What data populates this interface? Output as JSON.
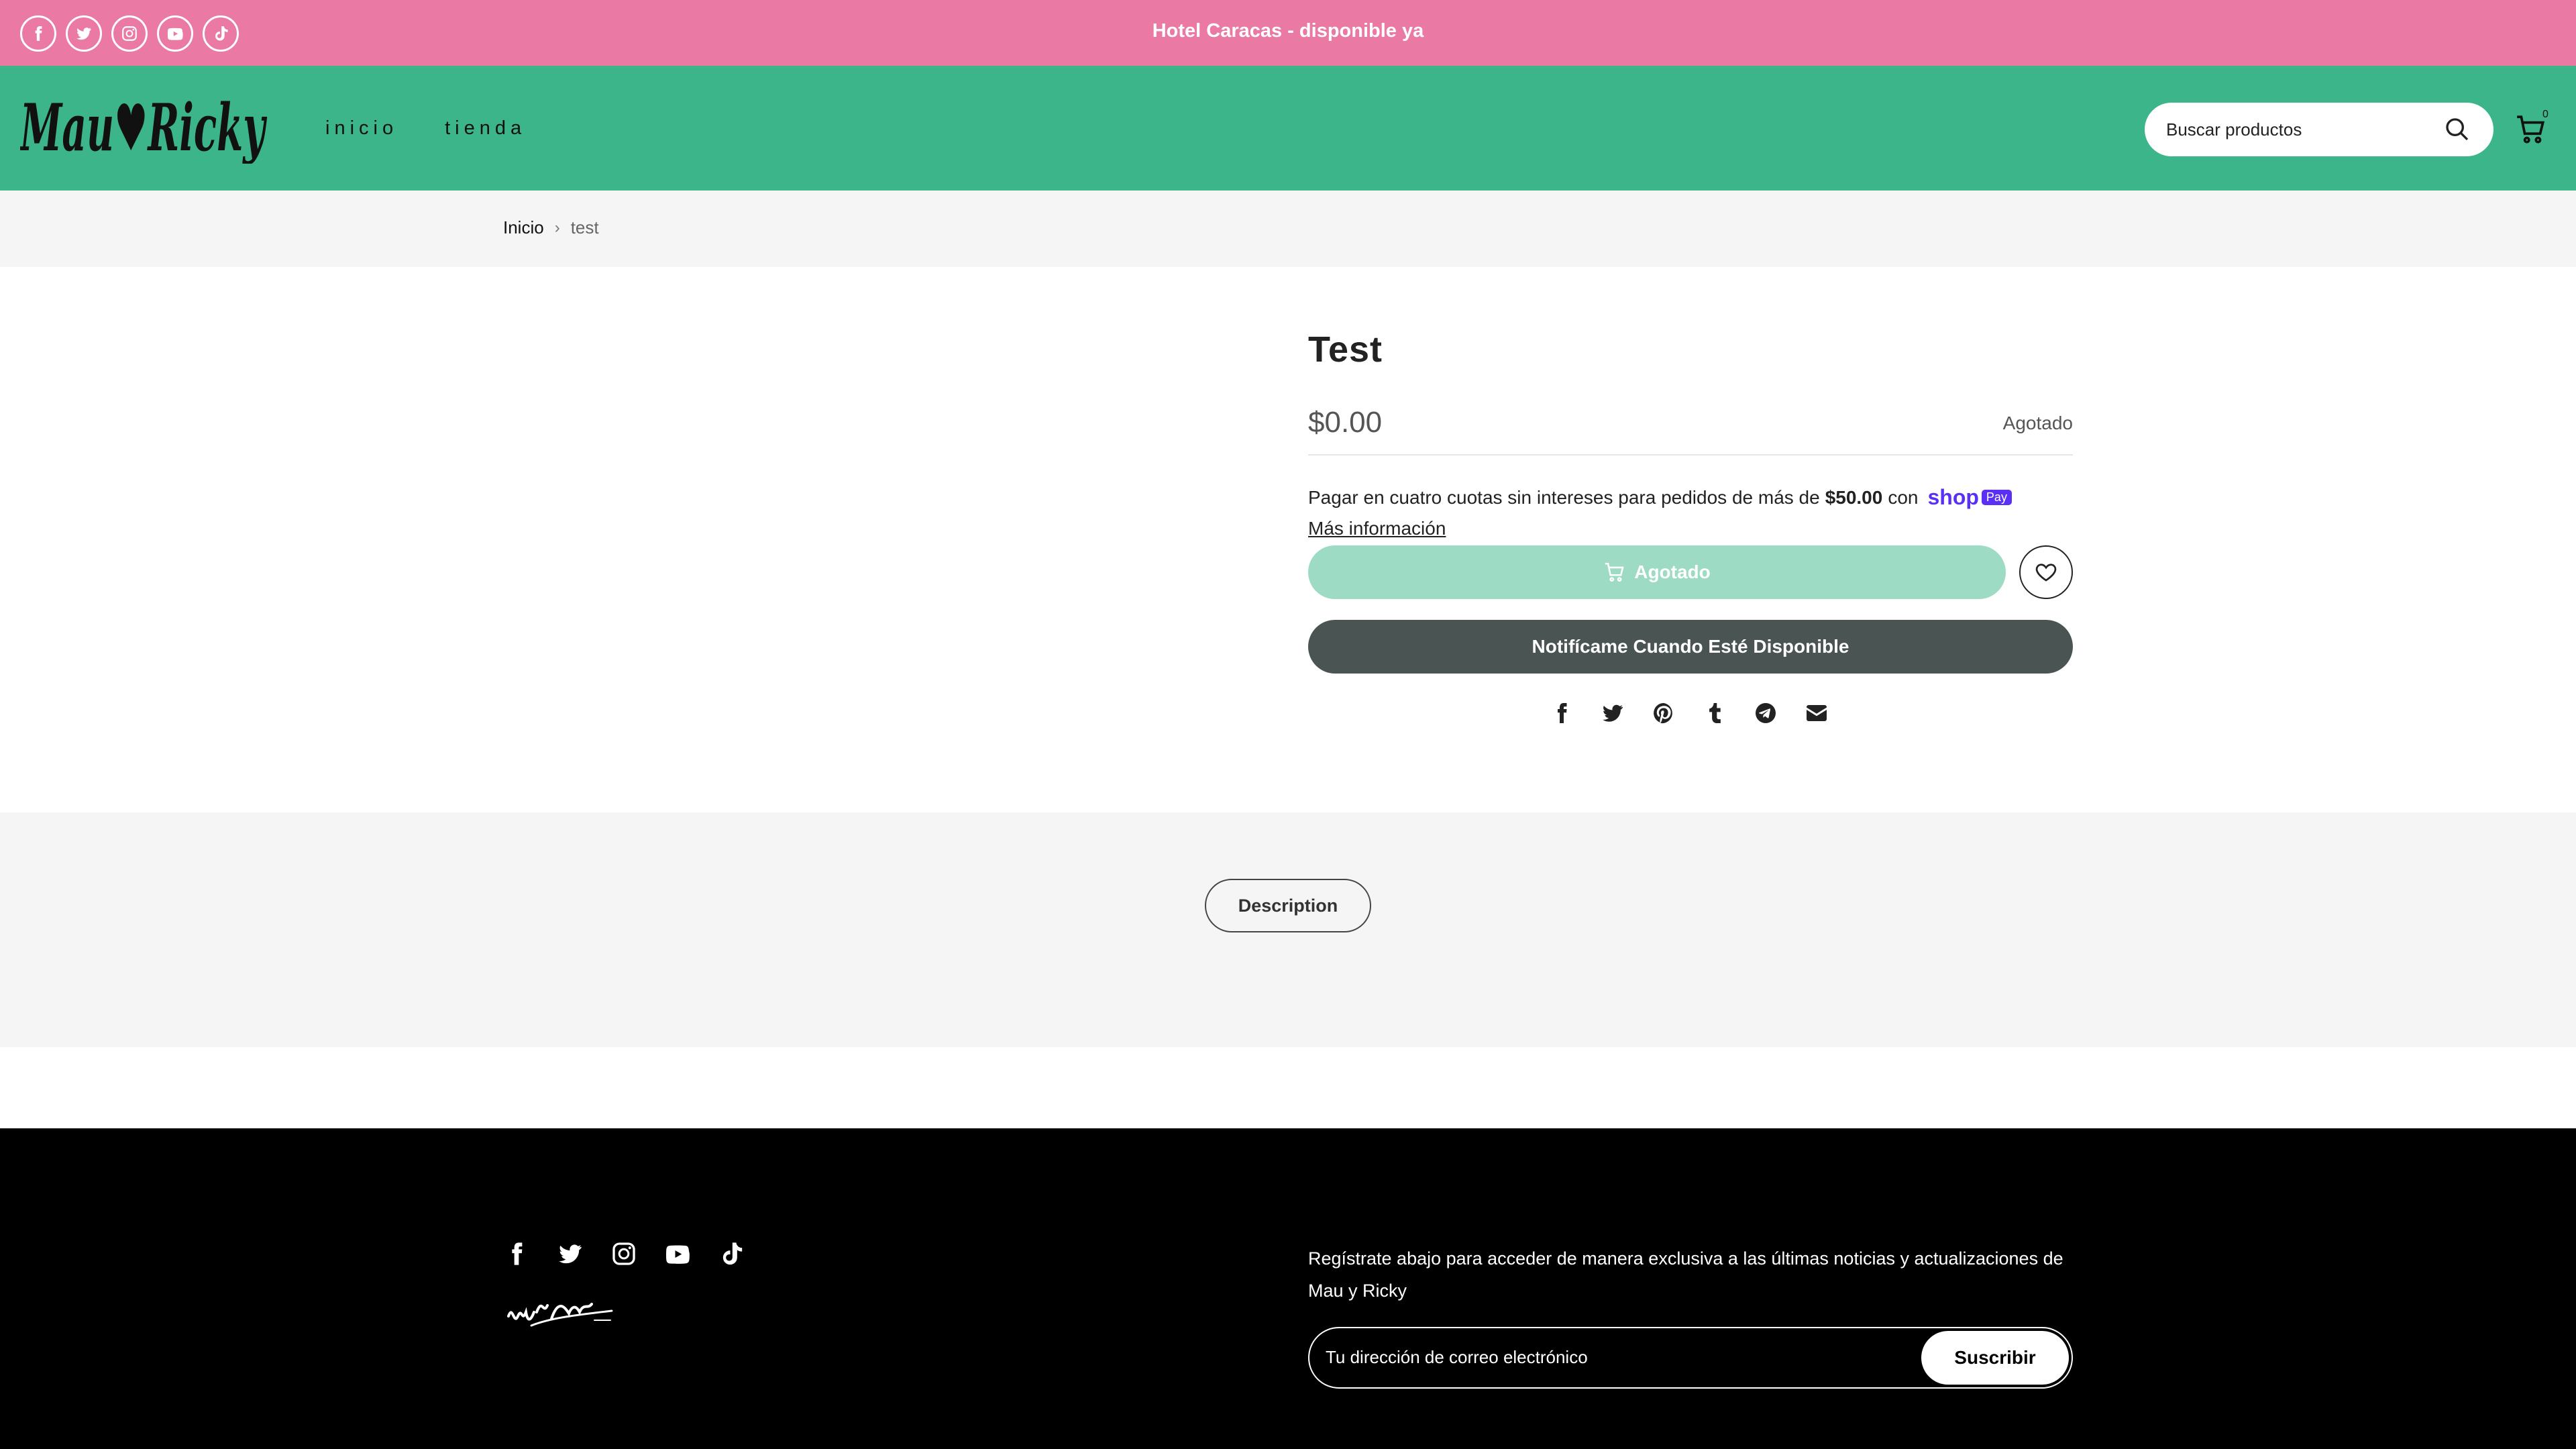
{
  "announcement": {
    "text": "Hotel Caracas - disponible ya",
    "socials": [
      "facebook-icon",
      "twitter-icon",
      "instagram-icon",
      "youtube-icon",
      "tiktok-icon"
    ]
  },
  "header": {
    "logo_text": "MauyRicky",
    "nav": [
      {
        "label": "inicio"
      },
      {
        "label": "tienda"
      }
    ],
    "search_placeholder": "Buscar productos",
    "cart_count": "0"
  },
  "breadcrumb": {
    "home": "Inicio",
    "separator": "›",
    "current": "test"
  },
  "product": {
    "title": "Test",
    "price": "$0.00",
    "stock_status": "Agotado",
    "installments_prefix": "Pagar en cuatro cuotas sin intereses para pedidos de más de",
    "installments_amount": "$50.00",
    "installments_suffix": "con",
    "shoppay_word": "shop",
    "shoppay_badge": "Pay",
    "more_info": "Más información",
    "soldout_button": "Agotado",
    "notify_button": "Notifícame Cuando Esté Disponible",
    "share": [
      "facebook-icon",
      "twitter-icon",
      "pinterest-icon",
      "tumblr-icon",
      "telegram-icon",
      "email-icon"
    ]
  },
  "tabs": {
    "description": "Description"
  },
  "footer": {
    "newsletter_text": "Regístrate abajo para acceder de manera exclusiva a las últimas noticias y actualizaciones de Mau y Ricky",
    "email_placeholder": "Tu dirección de correo electrónico",
    "subscribe": "Suscribir"
  },
  "colors": {
    "announcement_bg": "#ea7aa3",
    "header_bg": "#3bb589",
    "soldout_bg": "#9ddbc4",
    "notify_bg": "#4a5453",
    "footer_bg": "#000000",
    "shoppay": "#5a31f4"
  }
}
